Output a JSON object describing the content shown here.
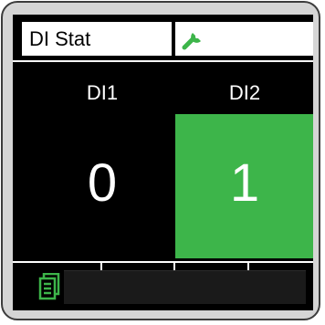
{
  "header": {
    "title": "DI Stat",
    "tool_icon": "wrench-icon"
  },
  "channels": [
    {
      "label": "DI1",
      "value": "0",
      "active": false
    },
    {
      "label": "DI2",
      "value": "1",
      "active": true
    }
  ],
  "footer": {
    "icon": "document-icon"
  },
  "colors": {
    "active": "#3db54a",
    "screen": "#000000",
    "bezel": "#d5d5d5",
    "icon_green": "#3db54a"
  }
}
